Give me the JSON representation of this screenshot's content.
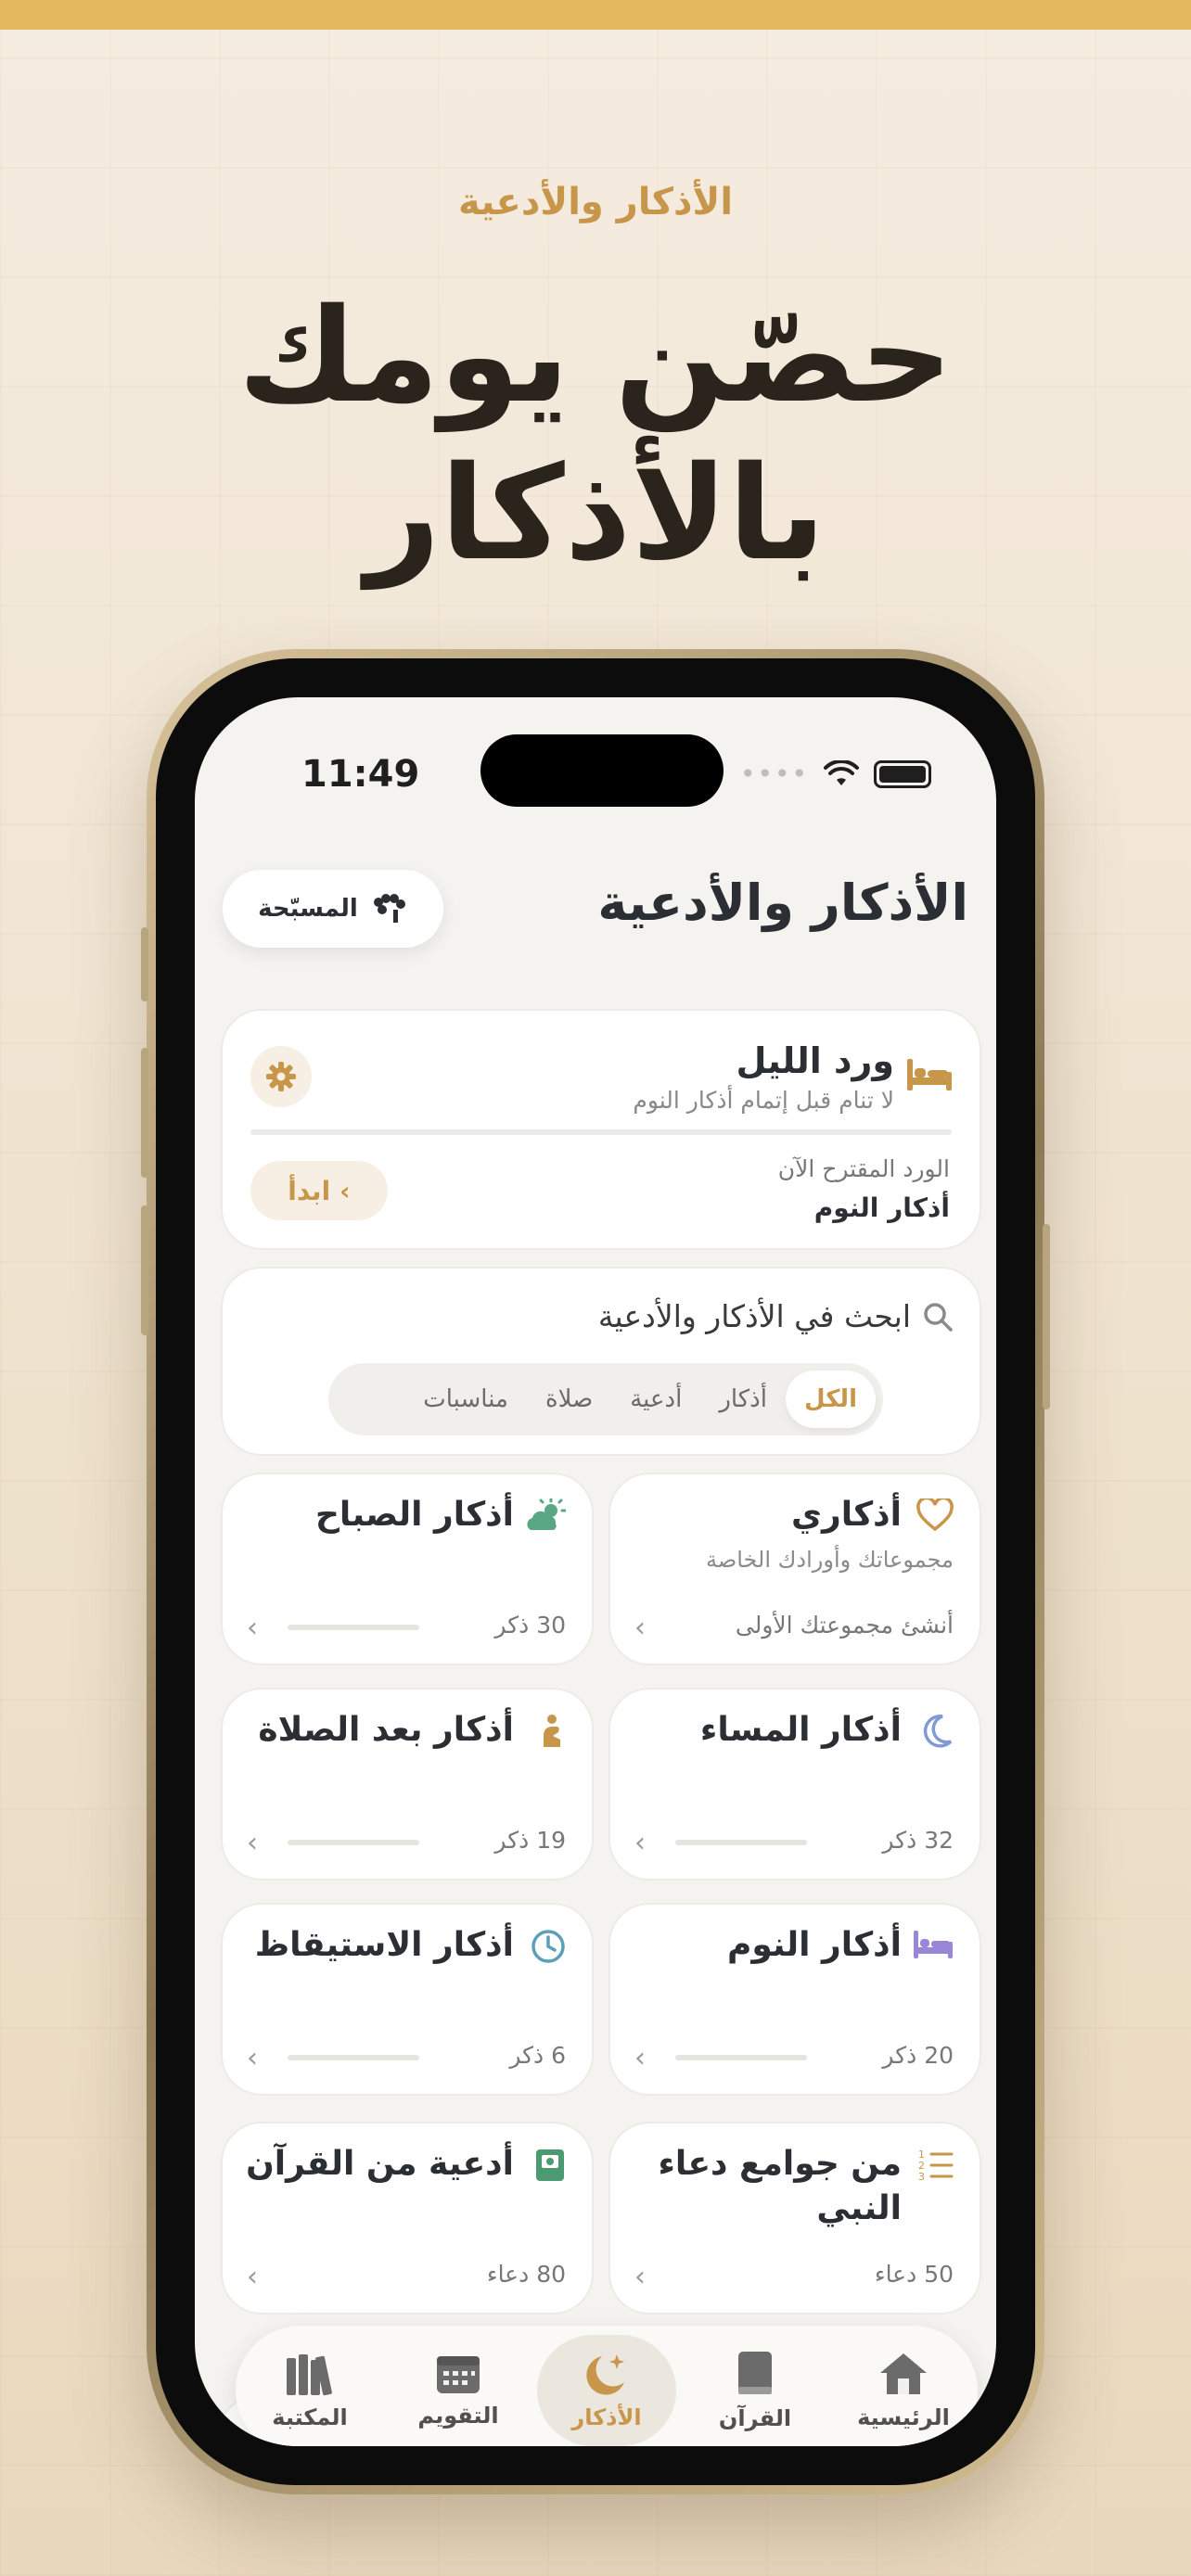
{
  "promo": {
    "kicker": "الأذكار والأدعية",
    "headline_line1": "حصّن يومك",
    "headline_line2": "بالأذكار"
  },
  "status_bar": {
    "time": "11:49",
    "dots": "••••"
  },
  "header": {
    "title": "الأذكار والأدعية",
    "misbaha_label": "المسبّحة"
  },
  "wird": {
    "title": "ورد الليل",
    "subtitle": "لا تنام قبل إتمام أذكار النوم",
    "suggested_label": "الورد المقترح الآن",
    "suggested_name": "أذكار النوم",
    "start_label": "ابدأ"
  },
  "search": {
    "placeholder": "ابحث في الأذكار والأدعية",
    "chips": [
      "الكل",
      "أذكار",
      "أدعية",
      "صلاة",
      "مناسبات"
    ],
    "active_chip": "الكل"
  },
  "categories": [
    {
      "title": "أذكاري",
      "subtitle": "مجموعاتك وأورادك الخاصة",
      "count": "أنشئ مجموعتك الأولى",
      "icon": "heart-icon",
      "color": "#c8964a"
    },
    {
      "title": "أذكار الصباح",
      "subtitle": "",
      "count": "30 ذكر",
      "icon": "sun-cloud-icon",
      "color": "#5aa784"
    },
    {
      "title": "أذكار المساء",
      "subtitle": "",
      "count": "32 ذكر",
      "icon": "moon-icon",
      "color": "#7f9bd6"
    },
    {
      "title": "أذكار بعد الصلاة",
      "subtitle": "",
      "count": "19 ذكر",
      "icon": "prayer-icon",
      "color": "#c8964a"
    },
    {
      "title": "أذكار النوم",
      "subtitle": "",
      "count": "20 ذكر",
      "icon": "bed-icon",
      "color": "#9a86d6"
    },
    {
      "title": "أذكار الاستيقاظ",
      "subtitle": "",
      "count": "6 ذكر",
      "icon": "clock-icon",
      "color": "#5b9fb8"
    },
    {
      "title": "من جوامع دعاء النبي",
      "subtitle": "",
      "count": "50 دعاء",
      "icon": "numbered-list-icon",
      "color": "#c8964a"
    },
    {
      "title": "أدعية من القرآن",
      "subtitle": "",
      "count": "80 دعاء",
      "icon": "quran-book-icon",
      "color": "#4c9a72"
    }
  ],
  "tabbar": {
    "home": "الرئيسية",
    "quran": "القرآن",
    "adhkar": "الأذكار",
    "calendar": "التقويم",
    "library": "المكتبة",
    "active": "الأذكار"
  },
  "colors": {
    "accent": "#c8964a",
    "text": "#2b2f33",
    "background": "#f5f3ef",
    "top_bar": "#e4b85c"
  }
}
